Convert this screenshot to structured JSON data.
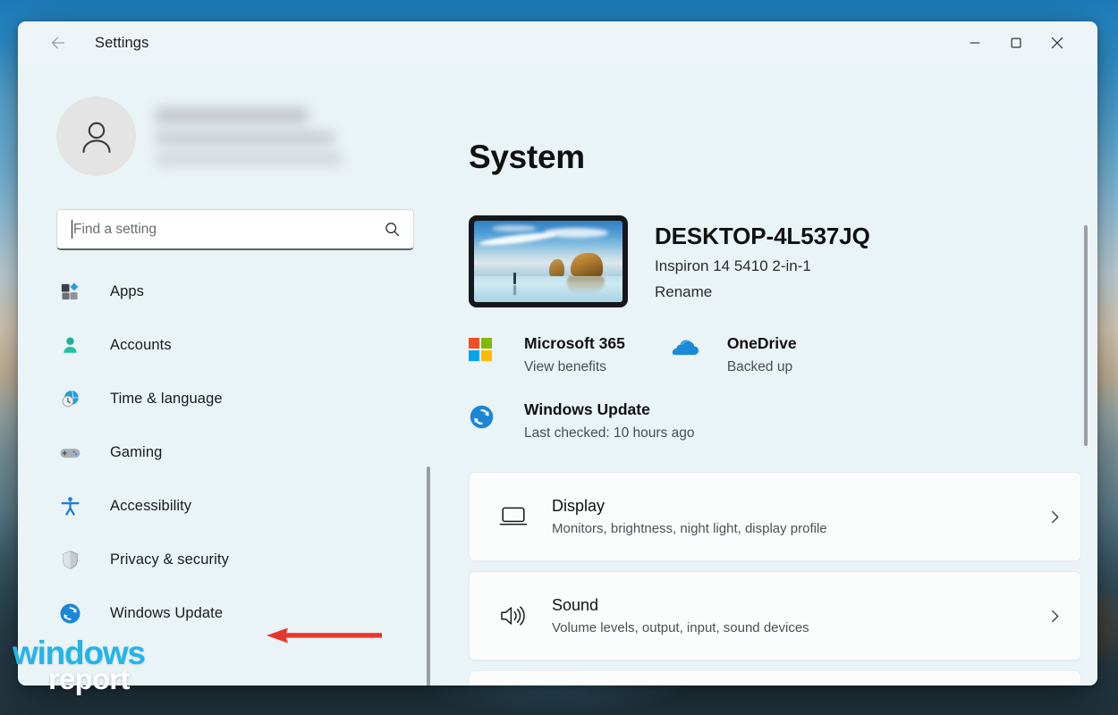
{
  "window": {
    "title": "Settings",
    "back_icon": "back-arrow-icon",
    "controls": {
      "minimize": "minimize-icon",
      "maximize": "maximize-icon",
      "close": "close-icon"
    }
  },
  "sidebar": {
    "account": {
      "avatar_icon": "person-avatar-icon",
      "name_redacted": "",
      "email_redacted": "",
      "detail_redacted": ""
    },
    "search": {
      "value": "",
      "placeholder": "Find a setting",
      "icon": "search-icon"
    },
    "items": [
      {
        "label": "Apps",
        "icon": "apps-icon"
      },
      {
        "label": "Accounts",
        "icon": "accounts-icon"
      },
      {
        "label": "Time & language",
        "icon": "clock-globe-icon"
      },
      {
        "label": "Gaming",
        "icon": "gamepad-icon"
      },
      {
        "label": "Accessibility",
        "icon": "accessibility-person-icon"
      },
      {
        "label": "Privacy & security",
        "icon": "shield-icon"
      },
      {
        "label": "Windows Update",
        "icon": "windows-update-refresh-icon"
      }
    ]
  },
  "main": {
    "page_title": "System",
    "device": {
      "thumbnail_icon": "device-wallpaper-thumbnail",
      "name": "DESKTOP-4L537JQ",
      "model": "Inspiron 14 5410 2-in-1",
      "rename_link": "Rename"
    },
    "status": [
      {
        "title": "Microsoft 365",
        "subtitle": "View benefits",
        "icon": "microsoft-logo-icon"
      },
      {
        "title": "OneDrive",
        "subtitle": "Backed up",
        "icon": "onedrive-cloud-icon"
      },
      {
        "title": "Windows Update",
        "subtitle": "Last checked: 10 hours ago",
        "icon": "windows-update-refresh-icon"
      }
    ],
    "cards": [
      {
        "title": "Display",
        "subtitle": "Monitors, brightness, night light, display profile",
        "icon": "monitor-icon",
        "chevron": "chevron-right-icon"
      },
      {
        "title": "Sound",
        "subtitle": "Volume levels, output, input, sound devices",
        "icon": "speaker-icon",
        "chevron": "chevron-right-icon"
      }
    ]
  },
  "annotation": {
    "arrow_icon": "red-left-arrow-annotation",
    "color": "#e8372a"
  },
  "watermark": {
    "line1": "windows",
    "line2": "report",
    "color1": "#25b4e8",
    "color2": "#ffffff"
  },
  "colors": {
    "window_bg": "#eaf3f6",
    "titlebar_bg": "#eff4f8",
    "card_bg": "#fbfdfd",
    "accent": "#0078d4"
  }
}
